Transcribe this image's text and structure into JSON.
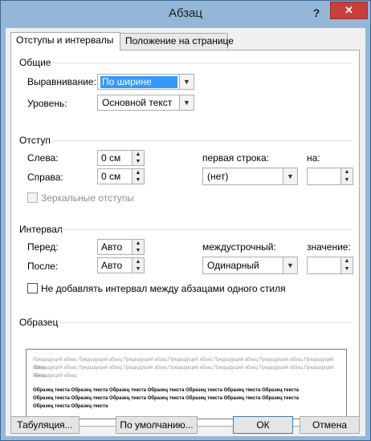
{
  "window": {
    "title": "Абзац",
    "help_label": "?",
    "close_label": "✕"
  },
  "tabs": [
    {
      "label": "Отступы и интервалы",
      "active": true
    },
    {
      "label": "Положение на странице",
      "active": false
    }
  ],
  "general": {
    "heading": "Общие",
    "alignment_label": "Выравнивание:",
    "alignment_value": "По ширине",
    "level_label": "Уровень:",
    "level_value": "Основной текст"
  },
  "indent": {
    "heading": "Отступ",
    "left_label": "Слева:",
    "left_value": "0 см",
    "right_label": "Справа:",
    "right_value": "0 см",
    "first_line_label": "первая строка:",
    "first_line_value": "(нет)",
    "by_label": "на:",
    "by_value": "",
    "mirror_label": "Зеркальные отступы"
  },
  "spacing": {
    "heading": "Интервал",
    "before_label": "Перед:",
    "before_value": "Авто",
    "after_label": "После:",
    "after_value": "Авто",
    "line_label": "междустрочный:",
    "line_value": "Одинарный",
    "at_label": "значение:",
    "at_value": "",
    "no_space_label": "Не добавлять интервал между абзацами одного стиля"
  },
  "preview": {
    "heading": "Образец",
    "prev_line1": "Предыдущий абзац Предыдущий абзац Предыдущий абзац Предыдущий абзац Предыдущий абзац Предыдущий абзац Предыдущий абзац",
    "prev_line2": "Предыдущий абзац Предыдущий абзац Предыдущий абзац Предыдущий абзац Предыдущий абзац Предыдущий абзац Предыдущий абзац",
    "prev_line3": "Предыдущий абзац",
    "sample_line1": "Образец текста Образец текста Образец текста Образец текста Образец текста Образец текста Образец текста",
    "sample_line2": "Образец текста Образец текста Образец текста Образец текста Образец текста Образец текста Образец текста",
    "sample_line3": "Образец текста Образец текста"
  },
  "buttons": {
    "tabs": "Табуляция...",
    "default": "По умолчанию...",
    "ok": "ОК",
    "cancel": "Отмена"
  }
}
